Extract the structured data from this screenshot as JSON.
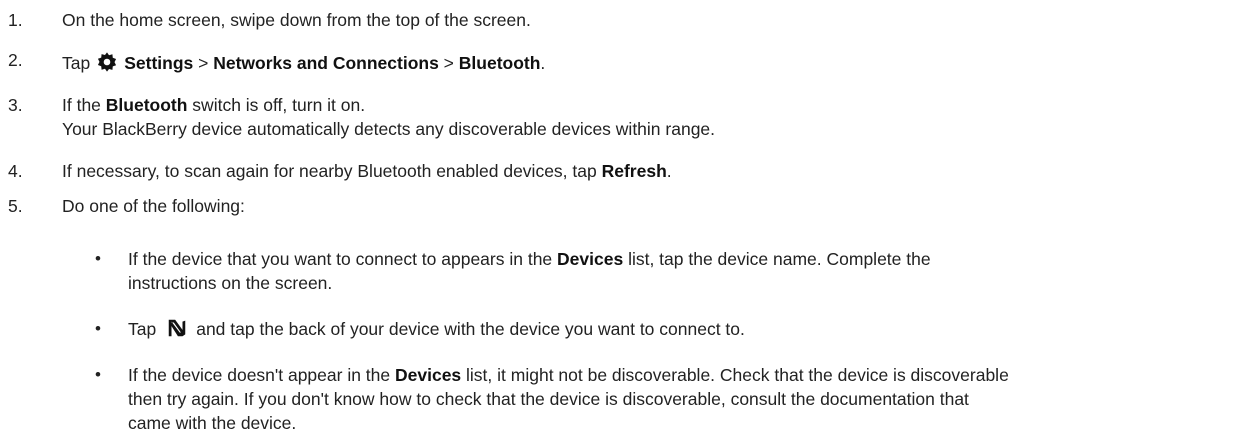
{
  "steps": [
    {
      "num": "1.",
      "text": "On the home screen, swipe down from the top of the screen."
    },
    {
      "num": "2.",
      "pre": "Tap",
      "icon": "gear-icon",
      "settings": "Settings",
      "sep1": " > ",
      "networks": "Networks and Connections",
      "sep2": " > ",
      "bluetooth": "Bluetooth",
      "end": "."
    },
    {
      "num": "3.",
      "pre": "If the ",
      "bold": "Bluetooth",
      "post": " switch is off, turn it on.",
      "line2": "Your BlackBerry device automatically detects any discoverable devices within range."
    },
    {
      "num": "4.",
      "pre": "If necessary, to scan again for nearby Bluetooth enabled devices, tap ",
      "bold": "Refresh",
      "post": "."
    },
    {
      "num": "5.",
      "text": "Do one of the following:"
    }
  ],
  "bullets": [
    {
      "dot": "•",
      "pre": "If the device that you want to connect to appears in the ",
      "bold": "Devices",
      "post": " list, tap the device name. Complete the",
      "line2": "instructions on the screen."
    },
    {
      "dot": "•",
      "pre": "Tap",
      "icon": "nfc-icon",
      "post": "and tap the back of your device with the device you want to connect to."
    },
    {
      "dot": "•",
      "pre": "If the device doesn't appear in the ",
      "bold": "Devices",
      "post": " list, it might not be discoverable. Check that the device is discoverable",
      "line2": "then try again. If you don't know how to check that the device is discoverable, consult the documentation that",
      "line3": "came with the device."
    }
  ]
}
